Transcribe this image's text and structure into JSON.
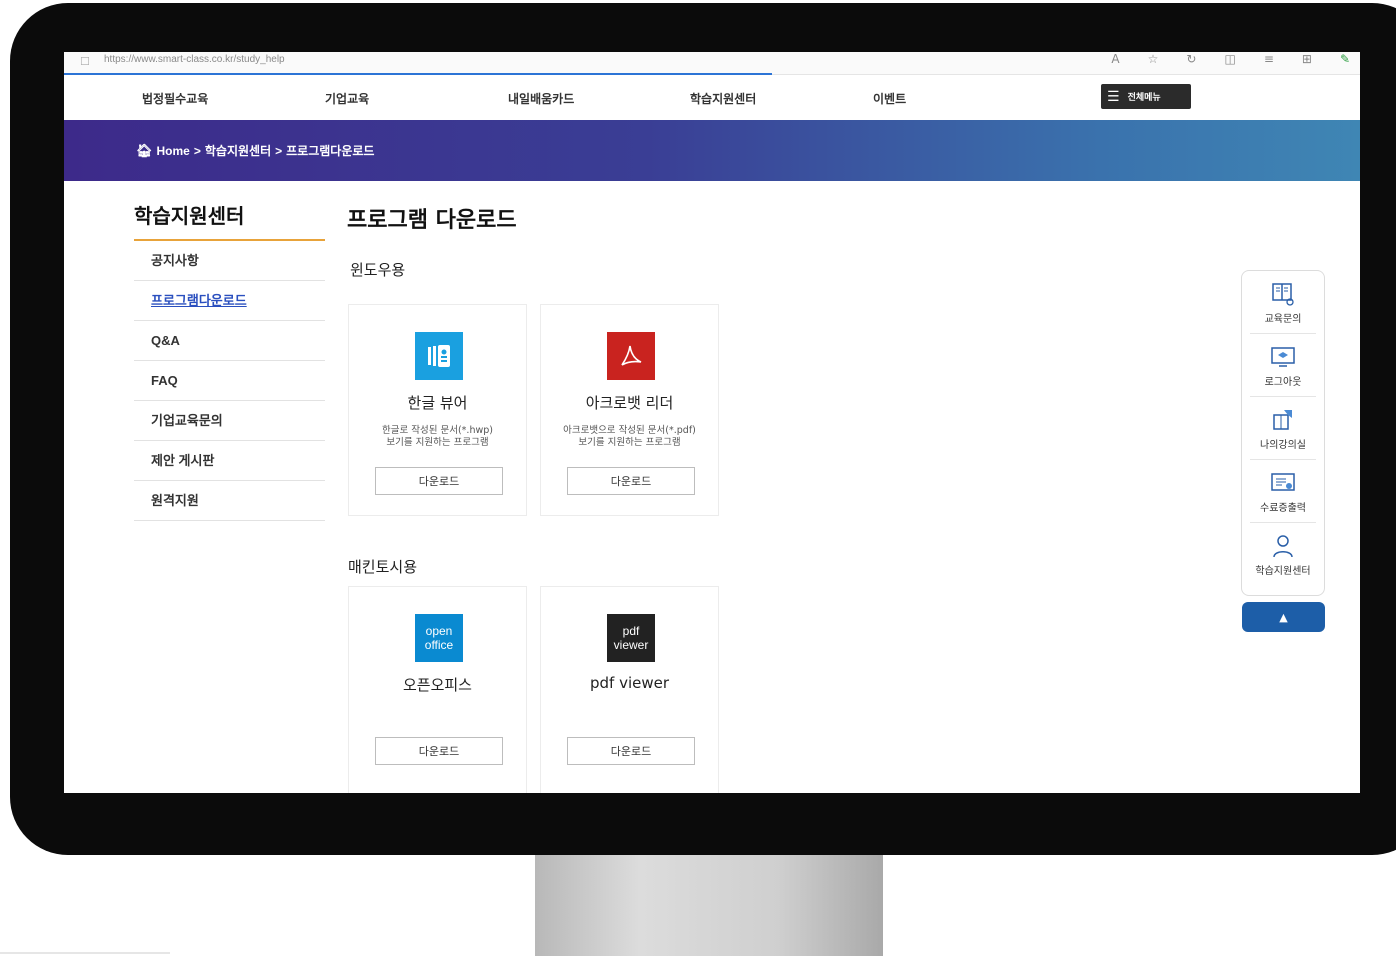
{
  "browser": {
    "url": "https://www.smart-class.co.kr/study_help"
  },
  "gnb": {
    "items": [
      "법정필수교육",
      "기업교육",
      "내일배움카드",
      "학습지원센터",
      "이벤트"
    ],
    "all_menu_label": "전체메뉴"
  },
  "breadcrumb": {
    "home": "Home",
    "sep1": ">",
    "level1": "학습지원센터",
    "sep2": ">",
    "level2": "프로그램다운로드"
  },
  "sidebar": {
    "title": "학습지원센터",
    "items": [
      "공지사항",
      "프로그램다운로드",
      "Q&A",
      "FAQ",
      "기업교육문의",
      "제안 게시판",
      "원격지원"
    ],
    "active_index": 1
  },
  "main": {
    "title": "프로그램 다운로드",
    "sections": [
      {
        "title": "윈도우용",
        "cards": [
          {
            "name": "한글 뷰어",
            "desc_line1": "한글로 작성된 문서(*.hwp)",
            "desc_line2": "보기를 지원하는 프로그램",
            "button": "다운로드",
            "icon": "hwp-viewer-icon"
          },
          {
            "name": "아크로뱃 리더",
            "desc_line1": "아크로뱃으로 작성된 문서(*.pdf)",
            "desc_line2": "보기를 지원하는 프로그램",
            "button": "다운로드",
            "icon": "acrobat-icon"
          }
        ]
      },
      {
        "title": "매킨토시용",
        "cards": [
          {
            "name": "오픈오피스",
            "logo_line1": "open",
            "logo_line2": "office",
            "button": "다운로드",
            "icon": "openoffice-icon"
          },
          {
            "name": "pdf viewer",
            "logo_line1": "pdf",
            "logo_line2": "viewer",
            "button": "다운로드",
            "icon": "pdf-viewer-icon"
          }
        ]
      }
    ]
  },
  "quick_menu": {
    "items": [
      {
        "label": "교육문의",
        "icon": "book-inquiry-icon"
      },
      {
        "label": "로그아웃",
        "icon": "monitor-graduation-icon"
      },
      {
        "label": "나의강의실",
        "icon": "puzzle-icon"
      },
      {
        "label": "수료증출력",
        "icon": "certificate-icon"
      },
      {
        "label": "학습지원센터",
        "icon": "person-icon"
      }
    ],
    "top_button": "▲"
  },
  "colors": {
    "banner_start": "#3d2a8a",
    "banner_end": "#3f86b4",
    "accent_underline": "#e8a33a",
    "active_link": "#2a4fbf",
    "top_button": "#1d5ea8"
  }
}
